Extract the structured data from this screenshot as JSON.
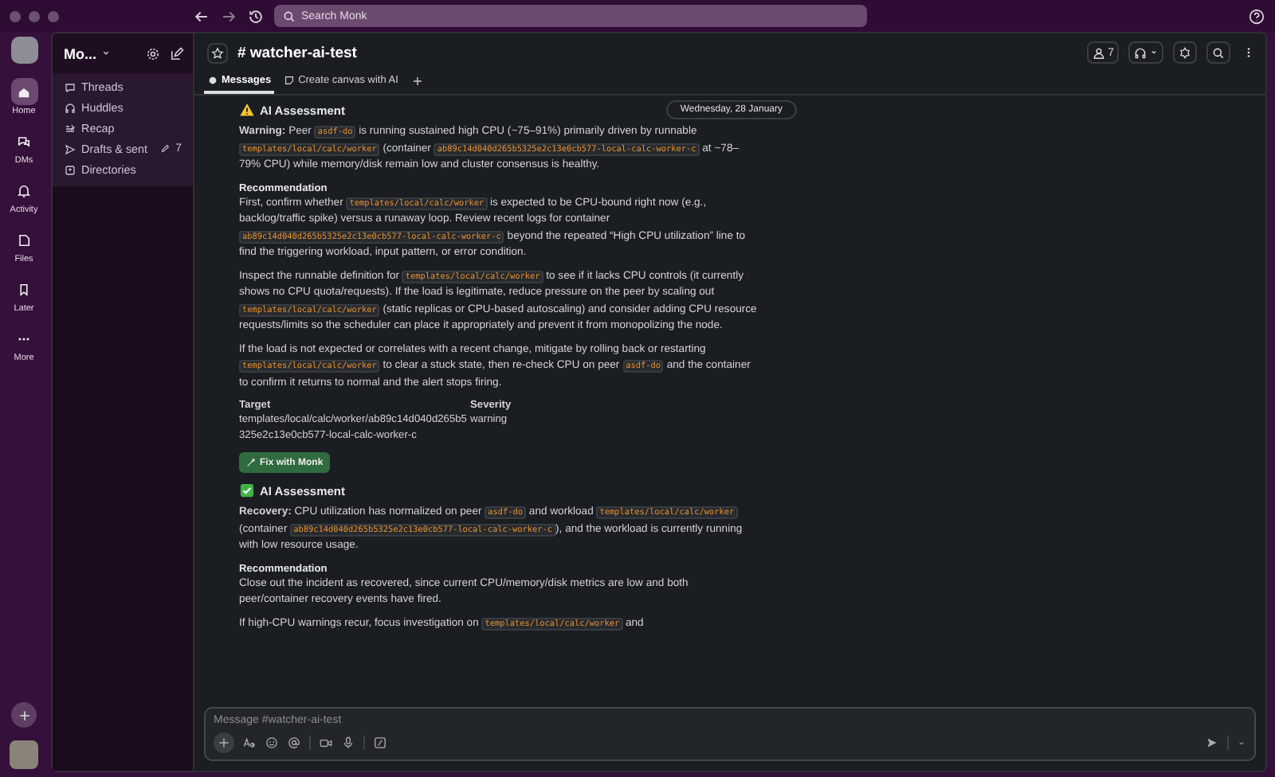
{
  "topbar": {
    "search": {
      "placeholder": "Search Monk"
    }
  },
  "rail": {
    "items": [
      {
        "label": "Home",
        "kind": "home",
        "selected": true
      },
      {
        "label": "DMs",
        "kind": "dms",
        "selected": false
      },
      {
        "label": "Activity",
        "kind": "bell",
        "selected": false
      },
      {
        "label": "Files",
        "kind": "files",
        "selected": false
      },
      {
        "label": "Later",
        "kind": "bookmark",
        "selected": false
      },
      {
        "label": "More",
        "kind": "dots",
        "selected": false
      }
    ]
  },
  "sidebar": {
    "workspace": "Mo...",
    "items": [
      {
        "label": "Threads",
        "kind": "threads"
      },
      {
        "label": "Huddles",
        "kind": "headphones"
      },
      {
        "label": "Recap",
        "kind": "recap"
      },
      {
        "label": "Drafts & sent",
        "kind": "send",
        "badge": "7"
      },
      {
        "label": "Directories",
        "kind": "directory"
      }
    ]
  },
  "channel": {
    "title": "# watcher-ai-test",
    "members": "7",
    "tabs": [
      {
        "label": "Messages",
        "kind": "bubble",
        "selected": true
      },
      {
        "label": "Create canvas with AI",
        "kind": "canvas",
        "selected": false
      }
    ]
  },
  "date_divider": "Wednesday, 28 January",
  "messages": [
    {
      "kind": "warning",
      "heading": "AI Assessment",
      "blocks": [
        {
          "kind": "para",
          "segments": [
            {
              "kind": "bold",
              "text": "Warning:"
            },
            {
              "kind": "text",
              "text": " Peer "
            },
            {
              "kind": "code",
              "text": "asdf-do"
            },
            {
              "kind": "text",
              "text": " is running sustained high CPU (~75–91%) primarily driven by runnable "
            },
            {
              "kind": "code",
              "text": "templates/local/calc/worker"
            },
            {
              "kind": "text",
              "text": " (container "
            },
            {
              "kind": "code",
              "text": "ab89c14d040d265b5325e2c13e0cb577-local-calc-worker-c"
            },
            {
              "kind": "text",
              "text": " at ~78–79% CPU) while memory/disk remain low and cluster consensus is healthy."
            }
          ]
        },
        {
          "kind": "heading",
          "text": "Recommendation"
        },
        {
          "kind": "para",
          "segments": [
            {
              "kind": "text",
              "text": "First, confirm whether "
            },
            {
              "kind": "code",
              "text": "templates/local/calc/worker"
            },
            {
              "kind": "text",
              "text": " is expected to be CPU-bound right now (e.g., backlog/traffic spike) versus a runaway loop. Review recent logs for container "
            },
            {
              "kind": "code",
              "text": "ab89c14d040d265b5325e2c13e0cb577-local-calc-worker-c"
            },
            {
              "kind": "text",
              "text": " beyond the repeated “High CPU utilization” line to find the triggering workload, input pattern, or error condition."
            }
          ]
        },
        {
          "kind": "para",
          "segments": [
            {
              "kind": "text",
              "text": "Inspect the runnable definition for "
            },
            {
              "kind": "code",
              "text": "templates/local/calc/worker"
            },
            {
              "kind": "text",
              "text": " to see if it lacks CPU controls (it currently shows no CPU quota/requests). If the load is legitimate, reduce pressure on the peer by scaling out "
            },
            {
              "kind": "code",
              "text": "templates/local/calc/worker"
            },
            {
              "kind": "text",
              "text": " (static replicas or CPU-based autoscaling) and consider adding CPU resource requests/limits so the scheduler can place it appropriately and prevent it from monopolizing the node."
            }
          ]
        },
        {
          "kind": "para",
          "segments": [
            {
              "kind": "text",
              "text": "If the load is not expected or correlates with a recent change, mitigate by rolling back or restarting "
            },
            {
              "kind": "code",
              "text": "templates/local/calc/worker"
            },
            {
              "kind": "text",
              "text": " to clear a stuck state, then re-check CPU on peer "
            },
            {
              "kind": "code",
              "text": "asdf-do"
            },
            {
              "kind": "text",
              "text": " and the container to confirm it returns to normal and the alert stops firing."
            }
          ]
        },
        {
          "kind": "fields",
          "fields": [
            {
              "label": "Target",
              "value": "templates/local/calc/worker/ab89c14d040d265b5325e2c13e0cb577-local-calc-worker-c"
            },
            {
              "label": "Severity",
              "value": "warning"
            }
          ]
        },
        {
          "kind": "button",
          "text": "Fix with Monk"
        }
      ]
    },
    {
      "kind": "ok",
      "heading": "AI Assessment",
      "blocks": [
        {
          "kind": "para",
          "segments": [
            {
              "kind": "bold",
              "text": "Recovery:"
            },
            {
              "kind": "text",
              "text": " CPU utilization has normalized on peer "
            },
            {
              "kind": "code",
              "text": "asdf-do"
            },
            {
              "kind": "text",
              "text": " and workload "
            },
            {
              "kind": "code",
              "text": "templates/local/calc/worker"
            },
            {
              "kind": "text",
              "text": " (container "
            },
            {
              "kind": "code",
              "text": "ab89c14d040d265b5325e2c13e0cb577-local-calc-worker-c"
            },
            {
              "kind": "text",
              "text": "), and the workload is currently running with low resource usage."
            }
          ]
        },
        {
          "kind": "heading",
          "text": "Recommendation"
        },
        {
          "kind": "para",
          "segments": [
            {
              "kind": "text",
              "text": "Close out the incident as recovered, since current CPU/memory/disk metrics are low and both peer/container recovery events have fired."
            }
          ]
        },
        {
          "kind": "para",
          "segments": [
            {
              "kind": "text",
              "text": "If high-CPU warnings recur, focus investigation on "
            },
            {
              "kind": "code",
              "text": "templates/local/calc/worker"
            },
            {
              "kind": "text",
              "text": " and"
            }
          ]
        }
      ]
    }
  ],
  "composer": {
    "placeholder": "Message #watcher-ai-test"
  }
}
